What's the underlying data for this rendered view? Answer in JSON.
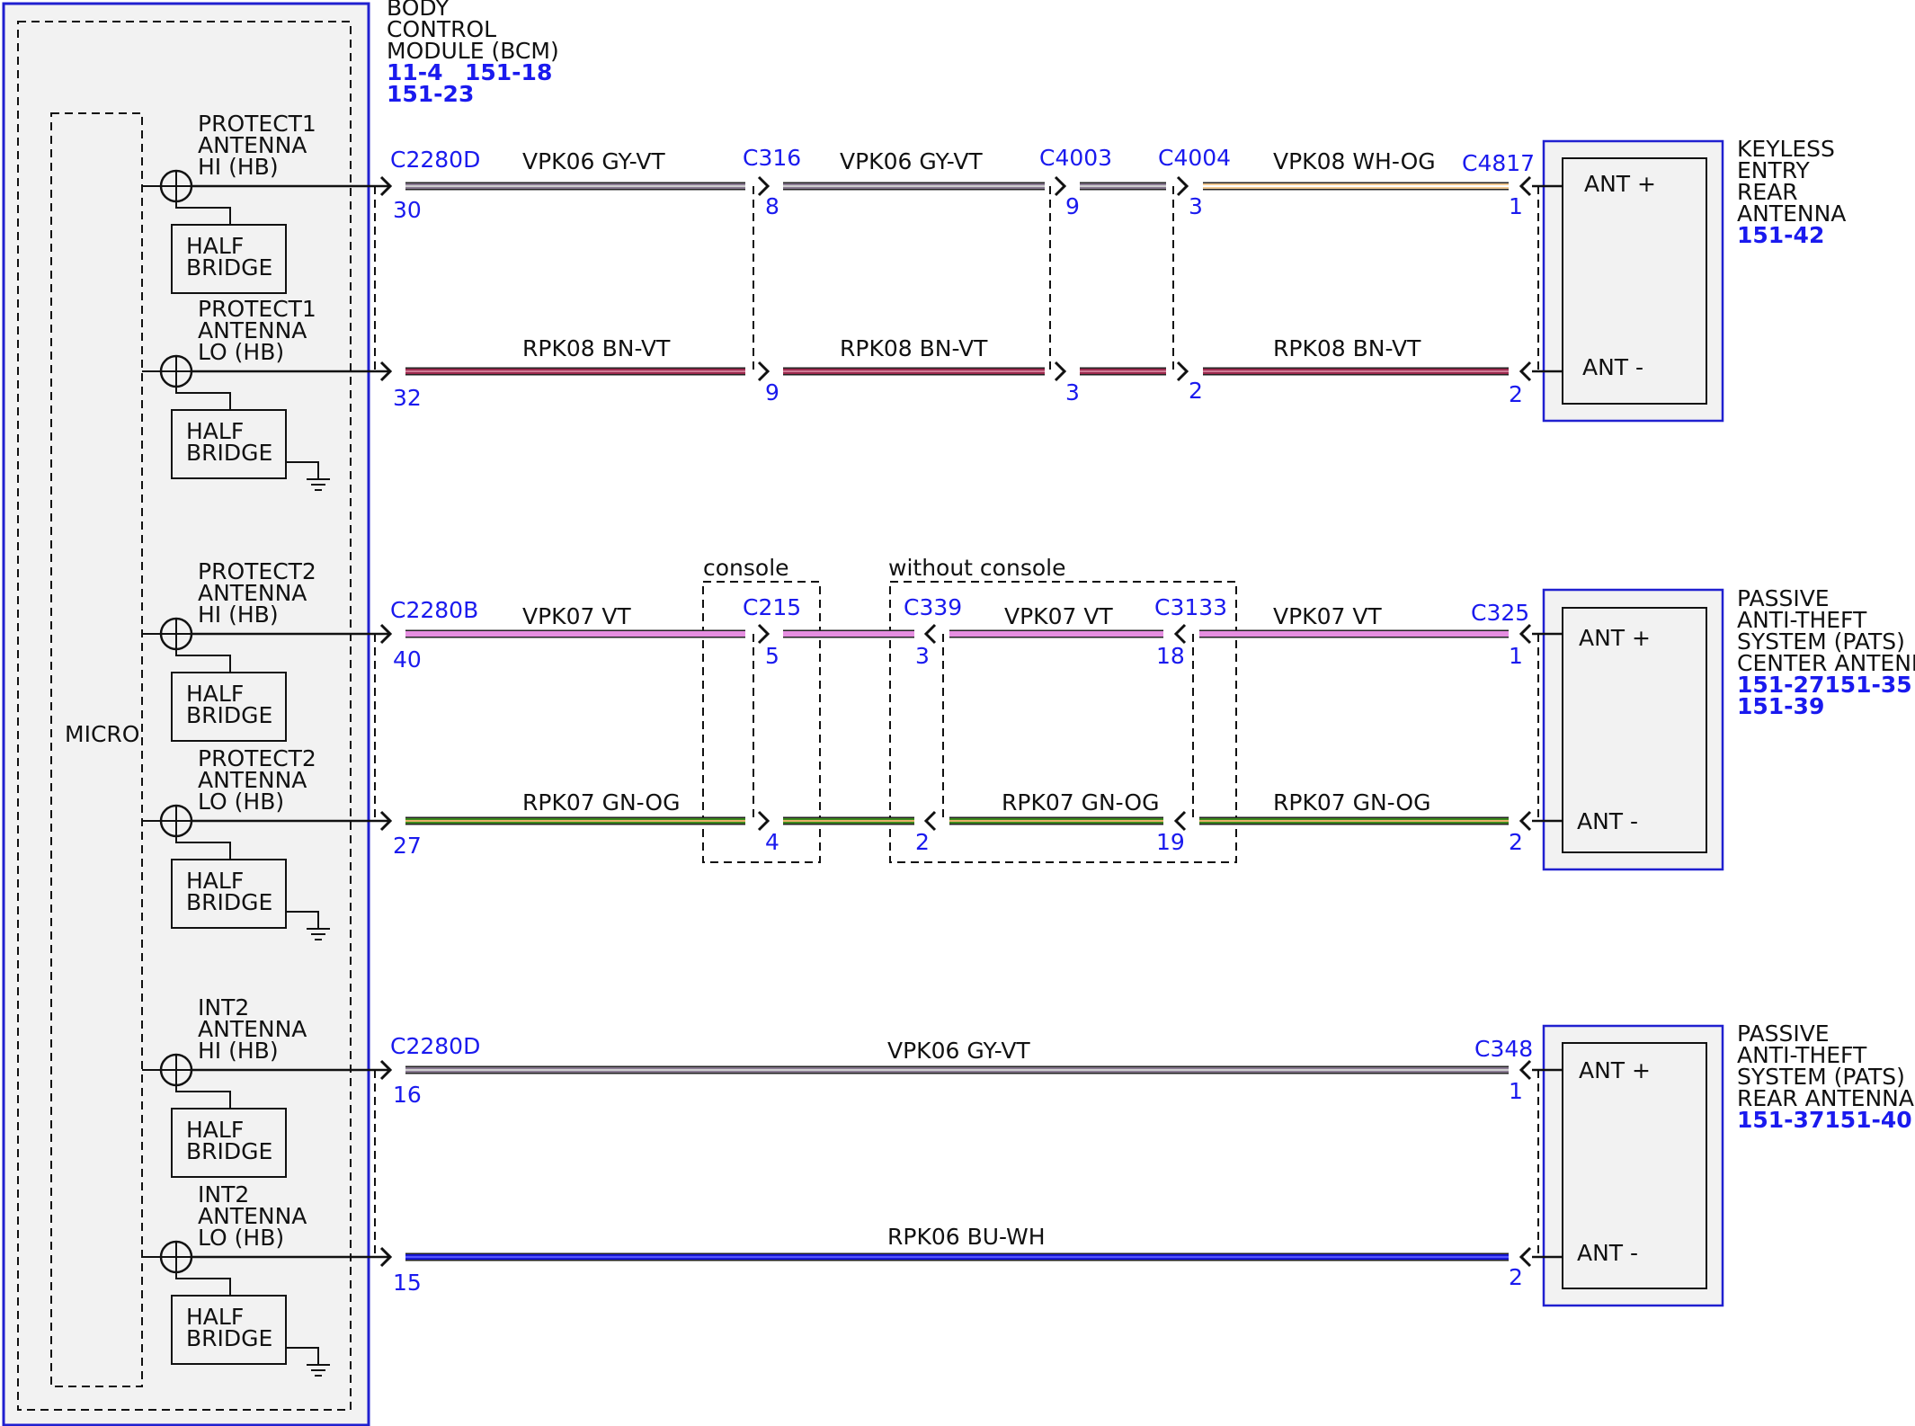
{
  "bcm": {
    "title_lines": [
      "BODY",
      "CONTROL",
      "MODULE (BCM)"
    ],
    "refs_line1": "11-4",
    "refs_line1b": "151-18",
    "refs_line2": "151-23",
    "micro_label": "MICRO",
    "half_bridge": [
      "HALF",
      "BRIDGE"
    ],
    "outputs": [
      {
        "lines": [
          "PROTECT1",
          "ANTENNA",
          "HI (HB)"
        ]
      },
      {
        "lines": [
          "PROTECT1",
          "ANTENNA",
          "LO (HB)"
        ]
      },
      {
        "lines": [
          "PROTECT2",
          "ANTENNA",
          "HI (HB)"
        ]
      },
      {
        "lines": [
          "PROTECT2",
          "ANTENNA",
          "LO (HB)"
        ]
      },
      {
        "lines": [
          "INT2",
          "ANTENNA",
          "HI (HB)"
        ]
      },
      {
        "lines": [
          "INT2",
          "ANTENNA",
          "LO (HB)"
        ]
      }
    ]
  },
  "components": [
    {
      "lines": [
        "KEYLESS",
        "ENTRY",
        "REAR",
        "ANTENNA"
      ],
      "refs": [
        "151-42"
      ],
      "pins": [
        "ANT +",
        "ANT -"
      ]
    },
    {
      "lines": [
        "PASSIVE",
        "ANTI-THEFT",
        "SYSTEM (PATS)",
        "CENTER ANTENNA"
      ],
      "refs": [
        "151-27151-35",
        "151-39"
      ],
      "pins": [
        "ANT +",
        "ANT -"
      ]
    },
    {
      "lines": [
        "PASSIVE",
        "ANTI-THEFT",
        "SYSTEM (PATS)",
        "REAR ANTENNA"
      ],
      "refs": [
        "151-37151-40"
      ],
      "pins": [
        "ANT +",
        "ANT -"
      ]
    }
  ],
  "connectors": {
    "c2280d_top": "C2280D",
    "c316": "C316",
    "c4003": "C4003",
    "c4004": "C4004",
    "c4817": "C4817",
    "c2280b": "C2280B",
    "c215": "C215",
    "c339": "C339",
    "c3133": "C3133",
    "c325": "C325",
    "c2280d_bottom": "C2280D",
    "c348": "C348"
  },
  "options": {
    "console": "console",
    "without_console": "without console"
  },
  "wires": {
    "w1a": "VPK06   GY-VT",
    "w1b": "VPK06   GY-VT",
    "w1c": "VPK08   WH-OG",
    "w2a": "RPK08   BN-VT",
    "w2b": "RPK08   BN-VT",
    "w2c": "RPK08   BN-VT",
    "w3a": "VPK07   VT",
    "w3b": "VPK07   VT",
    "w3c": "VPK07   VT",
    "w4a": "RPK07   GN-OG",
    "w4b": "RPK07   GN-OG",
    "w4c": "RPK07   GN-OG",
    "w5": "VPK06   GY-VT",
    "w6": "RPK06   BU-WH"
  },
  "pins": {
    "r1": [
      "30",
      "8",
      "9",
      "3",
      "1"
    ],
    "r2": [
      "32",
      "9",
      "3",
      "2",
      "2"
    ],
    "r3": [
      "40",
      "5",
      "3",
      "18",
      "1"
    ],
    "r4": [
      "27",
      "4",
      "2",
      "19",
      "2"
    ],
    "r5": [
      "16",
      "1"
    ],
    "r6": [
      "15",
      "2"
    ]
  },
  "wire_colors": {
    "gy_vt": "#8a7b92",
    "wh_og": "#f2c891",
    "bn_vt": "#9c2a4e",
    "vt": "#e58ee0",
    "gn_og": "#3c8a1c",
    "bu_wh": "#1a1ad6",
    "frame_blue": "#2020d0",
    "label_blue": "#1a1aee"
  }
}
